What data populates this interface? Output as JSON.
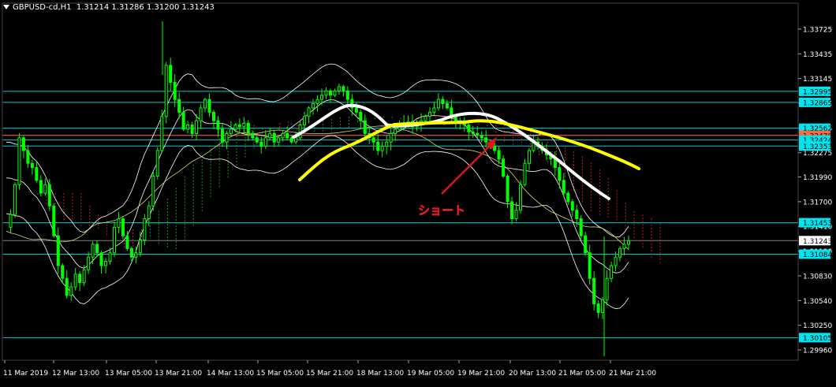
{
  "header": {
    "symbol": "GBPUSD-cd,H1",
    "ohlc": "1.31214 1.31286 1.31200 1.31243"
  },
  "annotation": {
    "label": "ショート"
  },
  "colors": {
    "background": "#000000",
    "bull_candle": "#00ff00",
    "bear_candle": "#00ff00",
    "bollinger": "#ffffff",
    "level_line": "#00c8c8",
    "current_price": "#ff6a3d",
    "ichimoku_bull": "#1e8f1e",
    "ichimoku_bear": "#c81e1e",
    "annotation_arrow": "#e0141e",
    "white_trend": "#ffffff",
    "yellow_trend": "#ffff00"
  },
  "chart_data": {
    "type": "candlestick",
    "instrument": "GBPUSD",
    "timeframe": "H1",
    "ylim": [
      1.2984,
      1.339
    ],
    "y_ticks": [
      1.33725,
      1.33435,
      1.33145,
      1.32855,
      1.32565,
      1.32275,
      1.3199,
      1.317,
      1.3141,
      1.3112,
      1.3083,
      1.3054,
      1.3025,
      1.2996
    ],
    "y_tick_labels": [
      "1.33725",
      "1.33435",
      "1.33145",
      "1.32855",
      "1.32565",
      "1.32275",
      "1.31990",
      "1.31700",
      "1.31410",
      "1.31120",
      "1.30830",
      "1.30540",
      "1.30250",
      "1.29960"
    ],
    "x_tick_labels": [
      "11 Mar 2019",
      "12 Mar 13:00",
      "13 Mar 05:00",
      "13 Mar 21:00",
      "14 Mar 13:00",
      "15 Mar 05:00",
      "15 Mar 21:00",
      "18 Mar 13:00",
      "19 Mar 05:00",
      "19 Mar 21:00",
      "20 Mar 13:00",
      "21 Mar 05:00",
      "21 Mar 21:00"
    ],
    "levels": [
      {
        "value": 1.32995,
        "label": "1.32995",
        "kind": "level"
      },
      {
        "value": 1.32865,
        "label": "1.32865",
        "kind": "level"
      },
      {
        "value": 1.32562,
        "label": "1.32562",
        "kind": "level"
      },
      {
        "value": 1.32478,
        "label": "1.32478",
        "kind": "current"
      },
      {
        "value": 1.32424,
        "label": "1.32424",
        "kind": "level"
      },
      {
        "value": 1.32353,
        "label": "1.32353",
        "kind": "level"
      },
      {
        "value": 1.31453,
        "label": "1.31453",
        "kind": "level"
      },
      {
        "value": 1.31243,
        "label": "1.31243",
        "kind": "price"
      },
      {
        "value": 1.31084,
        "label": "1.31084",
        "kind": "level"
      },
      {
        "value": 1.30105,
        "label": "1.30105",
        "kind": "level"
      }
    ],
    "close_path": [
      1.314,
      1.3155,
      1.319,
      1.3245,
      1.323,
      1.3215,
      1.321,
      1.3195,
      1.318,
      1.319,
      1.3165,
      1.313,
      1.3095,
      1.308,
      1.306,
      1.307,
      1.3085,
      1.3075,
      1.309,
      1.3105,
      1.312,
      1.311,
      1.3095,
      1.31,
      1.311,
      1.314,
      1.315,
      1.313,
      1.3115,
      1.3105,
      1.311,
      1.3125,
      1.315,
      1.3165,
      1.32,
      1.323,
      1.327,
      1.333,
      1.331,
      1.329,
      1.3275,
      1.3255,
      1.326,
      1.325,
      1.3265,
      1.328,
      1.329,
      1.3275,
      1.3265,
      1.3255,
      1.324,
      1.325,
      1.3255,
      1.326,
      1.3258,
      1.3262,
      1.325,
      1.3245,
      1.324,
      1.3235,
      1.3245,
      1.325,
      1.324,
      1.3245,
      1.325,
      1.3245,
      1.324,
      1.3245,
      1.326,
      1.327,
      1.328,
      1.3285,
      1.329,
      1.3295,
      1.33,
      1.3295,
      1.33,
      1.3305,
      1.33,
      1.329,
      1.328,
      1.3275,
      1.3265,
      1.325,
      1.3245,
      1.324,
      1.323,
      1.3235,
      1.324,
      1.325,
      1.3255,
      1.326,
      1.3262,
      1.3264,
      1.3258,
      1.326,
      1.3265,
      1.327,
      1.3275,
      1.328,
      1.329,
      1.3285,
      1.328,
      1.327,
      1.3262,
      1.3265,
      1.326,
      1.3252,
      1.325,
      1.3248,
      1.3245,
      1.324,
      1.3235,
      1.323,
      1.322,
      1.32,
      1.317,
      1.315,
      1.316,
      1.319,
      1.3215,
      1.323,
      1.324,
      1.3235,
      1.323,
      1.3225,
      1.322,
      1.321,
      1.3195,
      1.318,
      1.317,
      1.316,
      1.315,
      1.313,
      1.311,
      1.308,
      1.305,
      1.304,
      1.3055,
      1.308,
      1.3095,
      1.3105,
      1.3115,
      1.312,
      1.3124
    ]
  }
}
